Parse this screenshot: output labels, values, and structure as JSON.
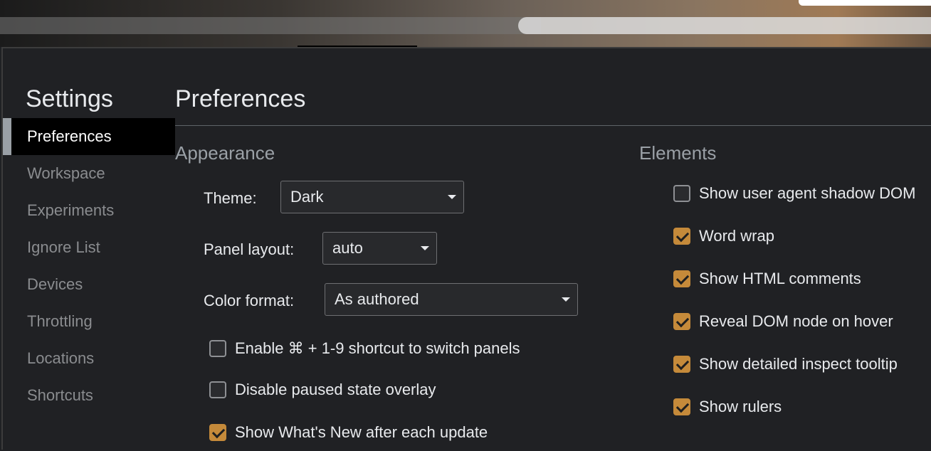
{
  "sidebar": {
    "title": "Settings",
    "items": [
      {
        "label": "Preferences",
        "selected": true
      },
      {
        "label": "Workspace"
      },
      {
        "label": "Experiments"
      },
      {
        "label": "Ignore List"
      },
      {
        "label": "Devices"
      },
      {
        "label": "Throttling"
      },
      {
        "label": "Locations"
      },
      {
        "label": "Shortcuts"
      }
    ]
  },
  "main": {
    "title": "Preferences",
    "appearance": {
      "title": "Appearance",
      "theme": {
        "label": "Theme:",
        "value": "Dark"
      },
      "panel_layout": {
        "label": "Panel layout:",
        "value": "auto"
      },
      "color_format": {
        "label": "Color format:",
        "value": "As authored"
      },
      "options": [
        {
          "label": "Enable ⌘ + 1-9 shortcut to switch panels",
          "checked": false
        },
        {
          "label": "Disable paused state overlay",
          "checked": false
        },
        {
          "label": "Show What's New after each update",
          "checked": true
        }
      ]
    },
    "elements": {
      "title": "Elements",
      "options": [
        {
          "label": "Show user agent shadow DOM",
          "checked": false
        },
        {
          "label": "Word wrap",
          "checked": true
        },
        {
          "label": "Show HTML comments",
          "checked": true
        },
        {
          "label": "Reveal DOM node on hover",
          "checked": true
        },
        {
          "label": "Show detailed inspect tooltip",
          "checked": true
        },
        {
          "label": "Show rulers",
          "checked": true
        }
      ]
    }
  },
  "colors": {
    "accent": "#c58a3a",
    "background": "#202124",
    "selected_nav": "#000000"
  }
}
